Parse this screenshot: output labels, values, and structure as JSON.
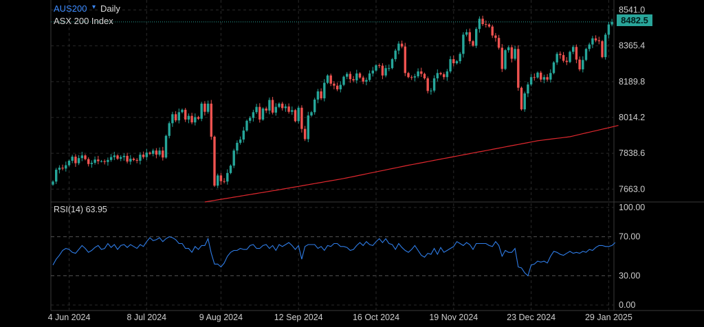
{
  "header": {
    "symbol": "AUS200",
    "dropdown_glyph": "▾",
    "timeframe": "Daily",
    "instrument_name": "ASX 200 Index",
    "last_price_label": "8482.5",
    "rsi_label": "RSI(14)",
    "rsi_value": "63.95"
  },
  "colors": {
    "background": "#000000",
    "grid": "#2a2a2a",
    "up_candle": "#26a69a",
    "down_candle": "#ef5350",
    "moving_average": "#e0282e",
    "rsi_line": "#2f7de8",
    "last_price_line": "#29a59a",
    "accent": "#3d8bff"
  },
  "chart_data": [
    {
      "type": "candlestick",
      "panel": "price",
      "y_ticks": [
        "8541.0",
        "8365.4",
        "8189.8",
        "8014.2",
        "7838.6",
        "7663.0"
      ],
      "ylim": [
        7600,
        8590
      ],
      "x_tick_labels": [
        "4 Jun 2024",
        "8 Jul 2024",
        "9 Aug 2024",
        "12 Sep 2024",
        "16 Oct 2024",
        "19 Nov 2024",
        "23 Dec 2024",
        "29 Jan 2025"
      ],
      "x_tick_bar_index": [
        5,
        29,
        52,
        76,
        100,
        124,
        148,
        172
      ],
      "last_price": 8482.5,
      "closes": [
        7700,
        7758,
        7768,
        7764,
        7780,
        7802,
        7822,
        7790,
        7815,
        7828,
        7810,
        7786,
        7792,
        7808,
        7800,
        7800,
        7796,
        7806,
        7820,
        7828,
        7812,
        7820,
        7826,
        7798,
        7812,
        7806,
        7802,
        7832,
        7820,
        7842,
        7836,
        7852,
        7832,
        7852,
        7818,
        7924,
        7986,
        8030,
        8000,
        8040,
        8052,
        8004,
        8022,
        7990,
        8016,
        8008,
        8082,
        8042,
        8082,
        7920,
        7680,
        7730,
        7702,
        7700,
        7742,
        7778,
        7852,
        7890,
        7906,
        7950,
        7998,
        8012,
        8040,
        8066,
        8004,
        8058,
        8048,
        8100,
        8038,
        8066,
        8082,
        8060,
        8068,
        8042,
        8050,
        7996,
        8062,
        7958,
        7908,
        8024,
        8040,
        8102,
        8142,
        8108,
        8184,
        8220,
        8180,
        8170,
        8152,
        8174,
        8214,
        8228,
        8202,
        8196,
        8230,
        8210,
        8190,
        8198,
        8230,
        8244,
        8270,
        8268,
        8220,
        8256,
        8256,
        8300,
        8342,
        8376,
        8362,
        8232,
        8212,
        8210,
        8216,
        8240,
        8228,
        8206,
        8144,
        8146,
        8206,
        8232,
        8226,
        8212,
        8240,
        8300,
        8280,
        8290,
        8326,
        8420,
        8432,
        8388,
        8366,
        8448,
        8498,
        8472,
        8470,
        8460,
        8416,
        8404,
        8356,
        8252,
        8344,
        8358,
        8302,
        8350,
        8160,
        8054,
        8132,
        8176,
        8212,
        8210,
        8234,
        8200,
        8212,
        8200,
        8232,
        8284,
        8326,
        8320,
        8292,
        8286,
        8336,
        8360,
        8298,
        8250,
        8296,
        8350,
        8372,
        8402,
        8392,
        8388,
        8310,
        8420,
        8470,
        8482.5
      ],
      "moving_average": {
        "name": "",
        "period_note": "",
        "values_sparse": [
          [
            47,
            7600
          ],
          [
            70,
            7660
          ],
          [
            90,
            7715
          ],
          [
            110,
            7780
          ],
          [
            130,
            7840
          ],
          [
            150,
            7900
          ],
          [
            160,
            7920
          ],
          [
            175,
            7975
          ]
        ]
      }
    },
    {
      "type": "line",
      "panel": "RSI(14)",
      "y_ticks": [
        "100.00",
        "70.00",
        "30.00",
        "0.00"
      ],
      "ylim": [
        0,
        100
      ],
      "reference_levels": [
        70,
        30
      ],
      "values": [
        41,
        47,
        51,
        56,
        58,
        57,
        54,
        53,
        57,
        61,
        58,
        54,
        56,
        59,
        61,
        57,
        58,
        63,
        59,
        62,
        57,
        61,
        62,
        59,
        62,
        60,
        58,
        62,
        60,
        65,
        69,
        66,
        67,
        69,
        65,
        68,
        70,
        69,
        67,
        63,
        63,
        58,
        58,
        54,
        60,
        57,
        61,
        61,
        68,
        53,
        42,
        42,
        39,
        43,
        50,
        54,
        56,
        56,
        58,
        57,
        57,
        61,
        62,
        58,
        58,
        61,
        62,
        58,
        61,
        56,
        62,
        60,
        62,
        64,
        61,
        57,
        61,
        47,
        60,
        62,
        62,
        62,
        58,
        60,
        56,
        61,
        60,
        63,
        63,
        60,
        60,
        59,
        56,
        57,
        61,
        64,
        61,
        65,
        62,
        61,
        65,
        68,
        64,
        68,
        63,
        62,
        57,
        63,
        59,
        56,
        54,
        57,
        61,
        56,
        51,
        49,
        53,
        52,
        58,
        52,
        59,
        54,
        56,
        58,
        60,
        65,
        63,
        61,
        64,
        62,
        57,
        63,
        63,
        63,
        63,
        61,
        60,
        65,
        61,
        50,
        56,
        54,
        54,
        58,
        39,
        38,
        33,
        30,
        41,
        42,
        45,
        44,
        45,
        43,
        50,
        55,
        54,
        52,
        51,
        53,
        55,
        53,
        54,
        53,
        55,
        54,
        57,
        56,
        59,
        61,
        61,
        60,
        60,
        61,
        64
      ]
    }
  ]
}
